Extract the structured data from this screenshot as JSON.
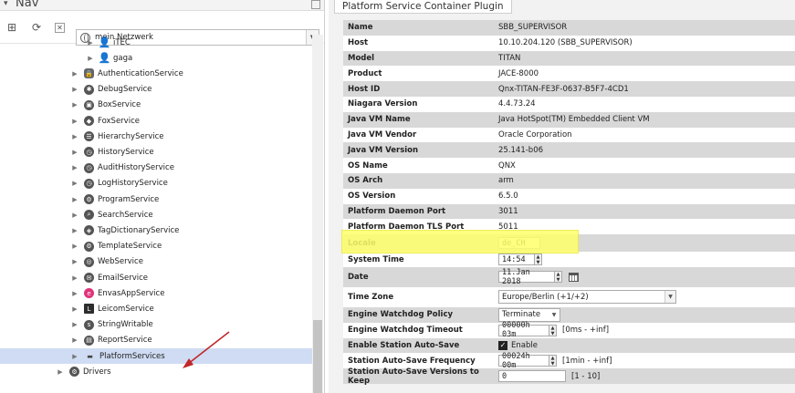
{
  "nav": {
    "title": "Nav",
    "network_selector": "mein Netzwerk",
    "tree": [
      {
        "label": "iTEC",
        "icon": "person-icon",
        "indent": 1
      },
      {
        "label": "gaga",
        "icon": "person-icon",
        "indent": 1
      },
      {
        "label": "AuthenticationService",
        "icon": "lock-icon",
        "indent": 0
      },
      {
        "label": "DebugService",
        "icon": "bug-icon",
        "indent": 0
      },
      {
        "label": "BoxService",
        "icon": "box-icon",
        "indent": 0
      },
      {
        "label": "FoxService",
        "icon": "fox-icon",
        "indent": 0
      },
      {
        "label": "HierarchyService",
        "icon": "hierarchy-icon",
        "indent": 0
      },
      {
        "label": "HistoryService",
        "icon": "history-icon",
        "indent": 0
      },
      {
        "label": "AuditHistoryService",
        "icon": "audit-icon",
        "indent": 0
      },
      {
        "label": "LogHistoryService",
        "icon": "log-icon",
        "indent": 0
      },
      {
        "label": "ProgramService",
        "icon": "program-icon",
        "indent": 0
      },
      {
        "label": "SearchService",
        "icon": "search-icon",
        "indent": 0
      },
      {
        "label": "TagDictionaryService",
        "icon": "tag-icon",
        "indent": 0
      },
      {
        "label": "TemplateService",
        "icon": "template-icon",
        "indent": 0
      },
      {
        "label": "WebService",
        "icon": "globe-icon",
        "indent": 0
      },
      {
        "label": "EmailService",
        "icon": "email-icon",
        "indent": 0
      },
      {
        "label": "EnvasAppService",
        "icon": "envas-icon",
        "indent": 0
      },
      {
        "label": "LeicomService",
        "icon": "leicom-icon",
        "indent": 0
      },
      {
        "label": "StringWritable",
        "icon": "string-icon",
        "indent": 0
      },
      {
        "label": "ReportService",
        "icon": "report-icon",
        "indent": 0
      },
      {
        "label": "PlatformServices",
        "icon": "platform-icon",
        "indent": 0,
        "selected": true
      },
      {
        "label": "Drivers",
        "icon": "drivers-icon",
        "indent": -1
      }
    ]
  },
  "plugin": {
    "tab_title": "Platform Service Container Plugin",
    "properties": [
      {
        "key": "Name",
        "value": "SBB_SUPERVISOR"
      },
      {
        "key": "Host",
        "value": "10.10.204.120 (SBB_SUPERVISOR)"
      },
      {
        "key": "Model",
        "value": "TITAN"
      },
      {
        "key": "Product",
        "value": "JACE-8000"
      },
      {
        "key": "Host ID",
        "value": "Qnx-TITAN-FE3F-0637-B5F7-4CD1"
      },
      {
        "key": "Niagara Version",
        "value": "4.4.73.24"
      },
      {
        "key": "Java VM Name",
        "value": "Java HotSpot(TM) Embedded Client VM"
      },
      {
        "key": "Java VM Vendor",
        "value": "Oracle Corporation"
      },
      {
        "key": "Java VM Version",
        "value": "25.141-b06"
      },
      {
        "key": "OS Name",
        "value": "QNX"
      },
      {
        "key": "OS Arch",
        "value": "arm"
      },
      {
        "key": "OS Version",
        "value": "6.5.0"
      },
      {
        "key": "Platform Daemon Port",
        "value": "3011"
      },
      {
        "key": "Platform Daemon TLS Port",
        "value": "5011"
      }
    ],
    "locale": {
      "key": "Locale",
      "value": "de_CH"
    },
    "system_time": {
      "key": "System Time",
      "value": "14:54"
    },
    "date": {
      "key": "Date",
      "value": "11.Jan 2018"
    },
    "time_zone": {
      "key": "Time Zone",
      "value": "Europe/Berlin (+1/+2)"
    },
    "watchdog_policy": {
      "key": "Engine Watchdog Policy",
      "value": "Terminate"
    },
    "watchdog_timeout": {
      "key": "Engine Watchdog Timeout",
      "value": "00000h 03m",
      "hint": "[0ms - +inf]"
    },
    "autosave": {
      "key": "Enable Station Auto-Save",
      "value": "Enable"
    },
    "autosave_freq": {
      "key": "Station Auto-Save Frequency",
      "value": "00024h 00m",
      "hint": "[1min - +inf]"
    },
    "autosave_versions": {
      "key": "Station Auto-Save Versions to Keep",
      "value": "0",
      "hint": "[1 - 10]"
    }
  },
  "colors": {
    "highlight": "#ffff6a",
    "selection": "#cfdcf3",
    "annotation_arrow": "#c0282a"
  }
}
